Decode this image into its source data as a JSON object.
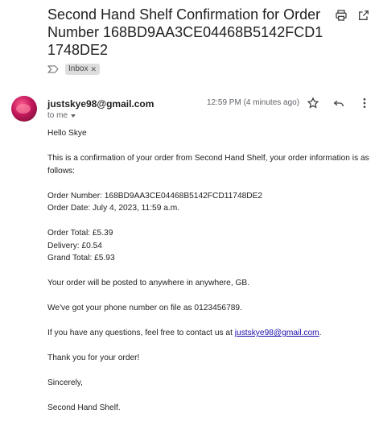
{
  "email": {
    "subject": "Second Hand Shelf Confirmation for Order Number 168BD9AA3CE04468B5142FCD11748DE2",
    "label": "Inbox",
    "sender": "justskye98@gmail.com",
    "recipient": "to me",
    "time": "12:59 PM (4 minutes ago)"
  },
  "body": {
    "greeting": "Hello Skye",
    "intro": "This is a confirmation of your order from Second Hand Shelf, your order information is as follows:",
    "order_number": "Order Number: 168BD9AA3CE04468B5142FCD11748DE2",
    "order_date": "Order Date: July 4, 2023, 11:59 a.m.",
    "order_total": "Order Total: £5.39",
    "delivery": "Delivery: £0.54",
    "grand_total": "Grand Total: £5.93",
    "posted": "Your order will be posted to anywhere in anywhere, GB.",
    "phone": "We've got your phone number on file as 0123456789.",
    "questions_prefix": "If you have any questions, feel free to contact us at ",
    "contact_email": "justskye98@gmail.com",
    "questions_suffix": ".",
    "thanks": "Thank you for your order!",
    "closing": "Sincerely,",
    "signature": "Second Hand Shelf."
  },
  "icons": {
    "print": "print-icon",
    "new_window": "open-in-new-window-icon",
    "star": "star-icon",
    "reply": "reply-icon",
    "more": "more-vertical-icon",
    "label_arrow": "label-arrow-icon"
  }
}
